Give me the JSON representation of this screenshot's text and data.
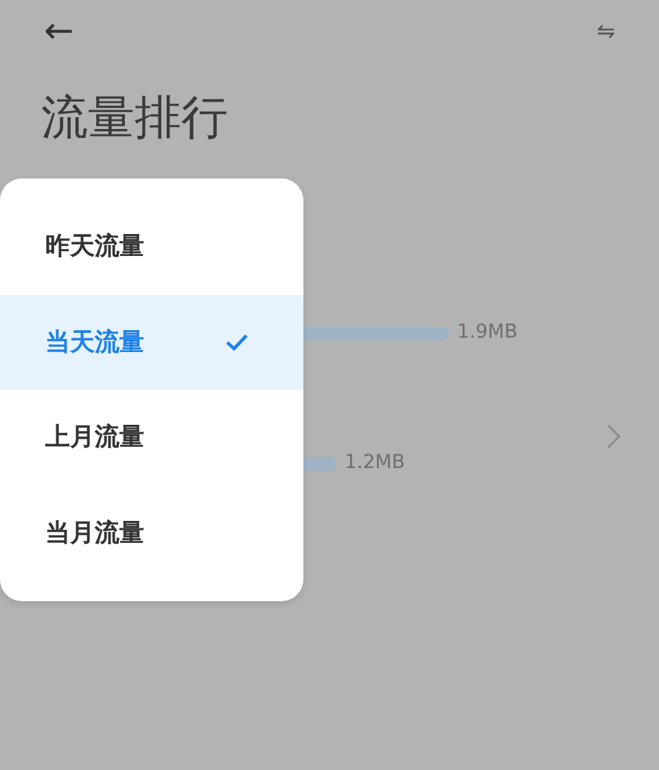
{
  "header": {
    "back": "←",
    "swap": "⇋"
  },
  "title": "流量排行",
  "apps": [
    {
      "usage": "1.9MB",
      "chevron": false
    },
    {
      "usage": "1.2MB",
      "chevron": true
    }
  ],
  "menu": [
    {
      "label": "昨天流量",
      "selected": false
    },
    {
      "label": "当天流量",
      "selected": true
    },
    {
      "label": "上月流量",
      "selected": false
    },
    {
      "label": "当月流量",
      "selected": false
    }
  ]
}
